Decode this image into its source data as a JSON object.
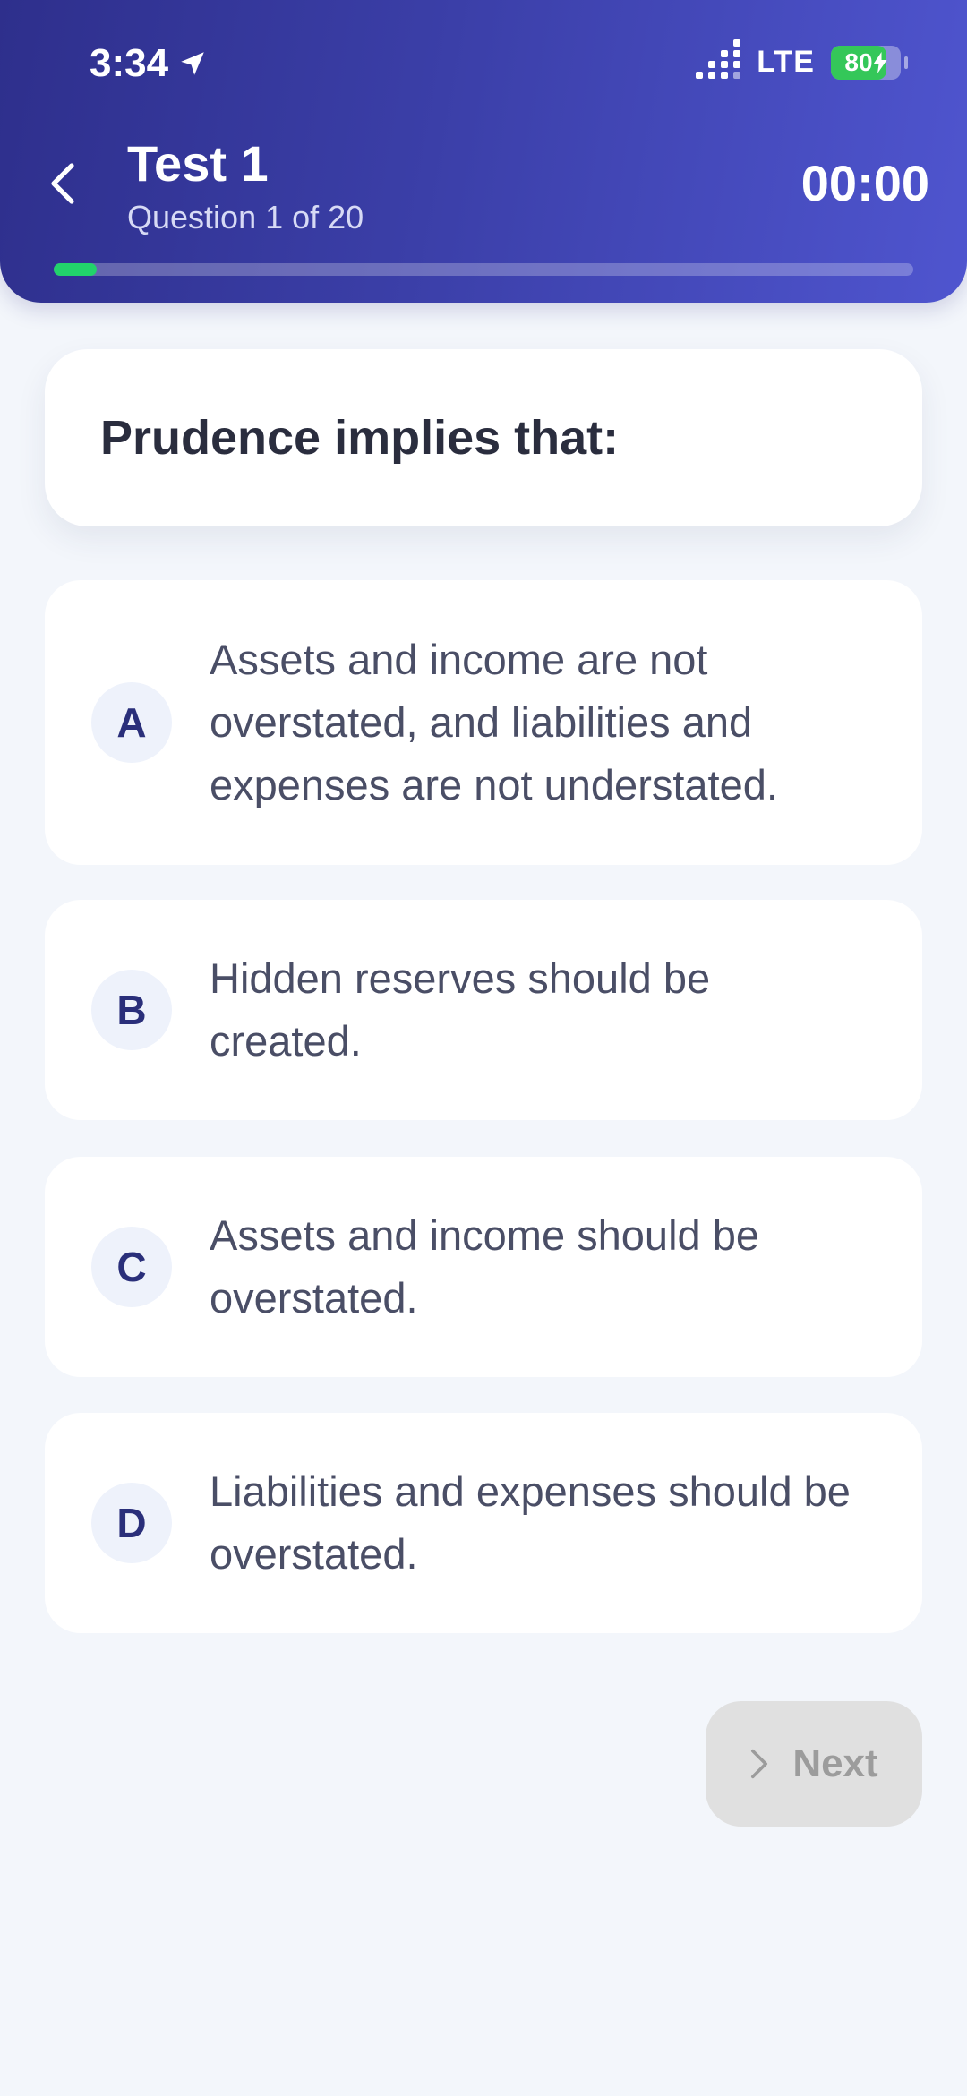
{
  "status_bar": {
    "time": "3:34",
    "network": "LTE",
    "battery_percent": 80,
    "battery_label": "80"
  },
  "header": {
    "title": "Test 1",
    "subtitle": "Question 1 of 20",
    "timer": "00:00",
    "progress_fraction": 0.05
  },
  "question": {
    "text": "Prudence implies that:"
  },
  "options": [
    {
      "letter": "A",
      "text": "Assets and income are not overstated, and liabilities and expenses are not understated."
    },
    {
      "letter": "B",
      "text": "Hidden reserves should be created."
    },
    {
      "letter": "C",
      "text": "Assets and income should be overstated."
    },
    {
      "letter": "D",
      "text": "Liabilities and expenses should be overstated."
    }
  ],
  "footer": {
    "next_label": "Next"
  },
  "colors": {
    "header_start": "#2e2f8c",
    "header_end": "#4f55cf",
    "progress": "#22d36b",
    "battery": "#34c759",
    "background": "#f3f6fb"
  }
}
